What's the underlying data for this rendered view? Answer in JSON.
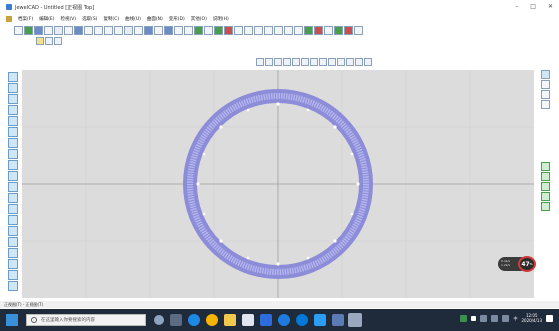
{
  "window": {
    "title": "JewelCAD - Untitled [正视图 Top]",
    "controls": [
      "–",
      "□",
      "✕"
    ]
  },
  "menu": {
    "items": [
      "档案(F)",
      "编辑(E)",
      "检视(V)",
      "选取(S)",
      "复制(C)",
      "曲线(U)",
      "曲面(N)",
      "变形(D)",
      "其他(O)",
      "说明(H)"
    ]
  },
  "canvas": {
    "view": "Top",
    "ring_color": "#8c8cd8",
    "axis_color": "#9e9e9e"
  },
  "speed_widget": {
    "up": "0.4k/s",
    "down": "1.2k/s",
    "percent": "47",
    "unit": "%"
  },
  "status": {
    "text": "正视图(T) - 正视图(T)"
  },
  "taskbar": {
    "search_placeholder": "在这里输入你要搜索的内容",
    "time": "12:05",
    "date": "2020/4/13",
    "tray_label": "中"
  }
}
